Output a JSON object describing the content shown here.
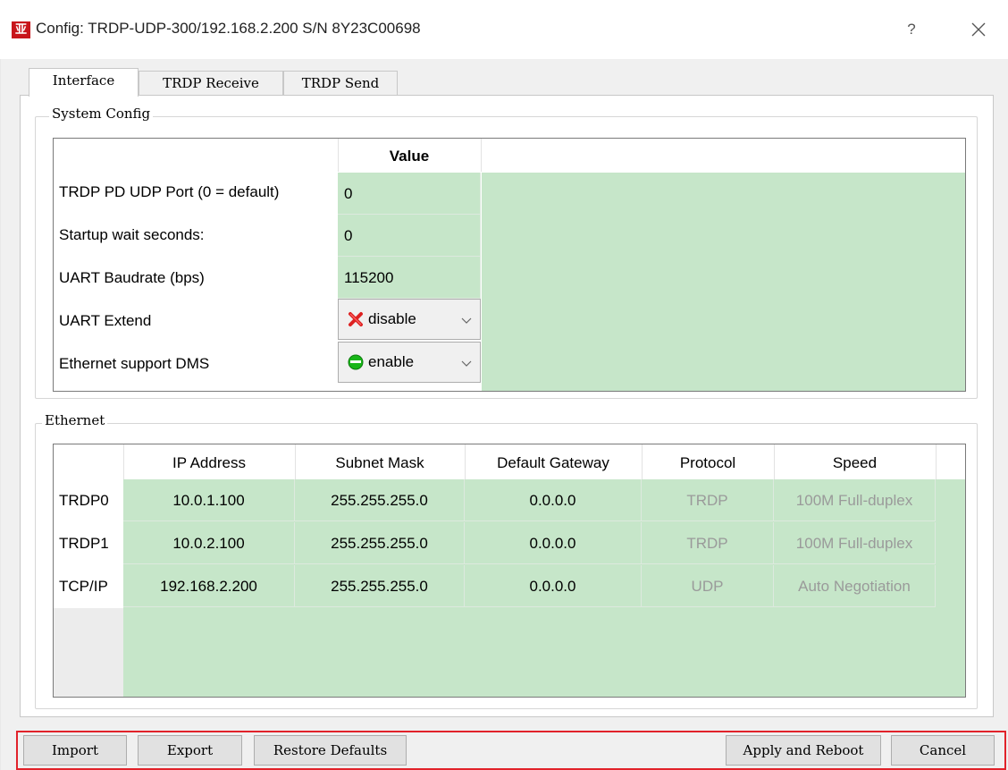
{
  "window": {
    "logo_text": "亚",
    "title": "Config: TRDP-UDP-300/192.168.2.200  S/N 8Y23C00698",
    "help_label": "?",
    "close_icon": "close-icon"
  },
  "tabs": [
    {
      "label": "Interface",
      "active": true
    },
    {
      "label": "TRDP Receive",
      "active": false
    },
    {
      "label": "TRDP Send",
      "active": false
    }
  ],
  "system_config": {
    "group_title": "System Config",
    "value_header": "Value",
    "rows": [
      {
        "label": "TRDP PD UDP Port (0 = default)",
        "value": "0"
      },
      {
        "label": "Startup wait seconds:",
        "value": "0"
      },
      {
        "label": "UART Baudrate (bps)",
        "value": "115200"
      },
      {
        "label": "UART Extend",
        "value": "disable",
        "icon": "red-x-icon"
      },
      {
        "label": "Ethernet support DMS",
        "value": "enable",
        "icon": "green-circle-icon"
      }
    ]
  },
  "ethernet": {
    "group_title": "Ethernet",
    "headers": [
      "IP Address",
      "Subnet Mask",
      "Default Gateway",
      "Protocol",
      "Speed"
    ],
    "rows": [
      {
        "name": "TRDP0",
        "ip": "10.0.1.100",
        "mask": "255.255.255.0",
        "gateway": "0.0.0.0",
        "protocol": "TRDP",
        "speed": "100M Full-duplex"
      },
      {
        "name": "TRDP1",
        "ip": "10.0.2.100",
        "mask": "255.255.255.0",
        "gateway": "0.0.0.0",
        "protocol": "TRDP",
        "speed": "100M Full-duplex"
      },
      {
        "name": "TCP/IP",
        "ip": "192.168.2.200",
        "mask": "255.255.255.0",
        "gateway": "0.0.0.0",
        "protocol": "UDP",
        "speed": "Auto Negotiation"
      }
    ]
  },
  "buttons": {
    "import": "Import",
    "export": "Export",
    "restore": "Restore Defaults",
    "apply": "Apply and Reboot",
    "cancel": "Cancel"
  },
  "colors": {
    "cell_green": "#c6e6c9",
    "highlight_frame": "#e1222a",
    "logo_red": "#c8151b"
  }
}
